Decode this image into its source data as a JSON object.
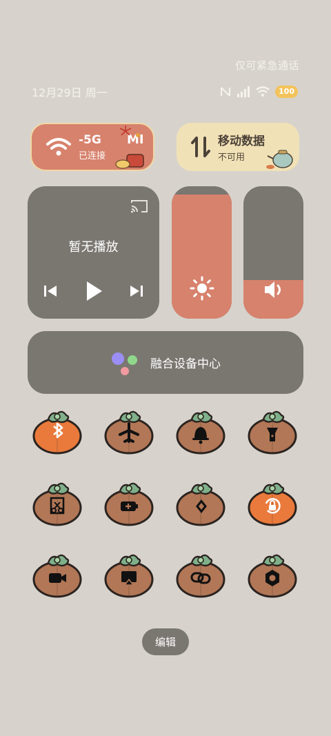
{
  "status": {
    "emergency": "仅可紧急通话",
    "date": "12月29日 周一",
    "battery": "100"
  },
  "wifi": {
    "name": "-5G",
    "brand": "MI",
    "state": "已连接"
  },
  "mobile_data": {
    "title": "移动数据",
    "state": "不可用"
  },
  "media": {
    "title": "暂无播放"
  },
  "brightness": {
    "level": 0.94
  },
  "volume": {
    "level": 0.29
  },
  "fusion": {
    "label": "融合设备中心"
  },
  "toggles": [
    {
      "name": "bluetooth",
      "active": true
    },
    {
      "name": "airplane",
      "active": false
    },
    {
      "name": "bell",
      "active": false
    },
    {
      "name": "flashlight",
      "active": false
    },
    {
      "name": "screenshot",
      "active": false
    },
    {
      "name": "battery-saver",
      "active": false
    },
    {
      "name": "nfc-forward",
      "active": false
    },
    {
      "name": "rotation-lock",
      "active": true
    },
    {
      "name": "video",
      "active": false
    },
    {
      "name": "screen-cast",
      "active": false
    },
    {
      "name": "link",
      "active": false
    },
    {
      "name": "settings",
      "active": false
    }
  ],
  "edit": {
    "label": "编辑"
  },
  "colors": {
    "active": "#e97a3c",
    "inactive": "#b27756",
    "accent": "#d7826d"
  }
}
